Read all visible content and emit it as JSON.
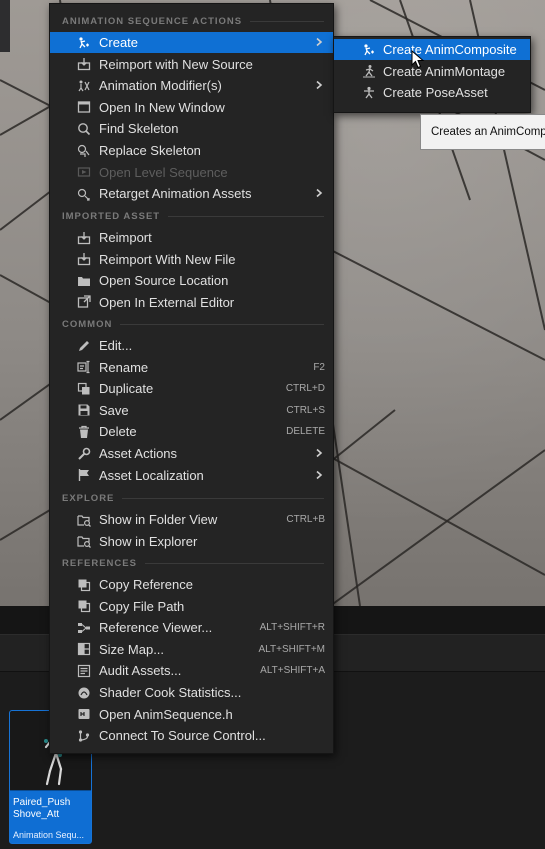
{
  "context_menu": {
    "sections": [
      {
        "header": "ANIMATION SEQUENCE ACTIONS",
        "items": [
          {
            "label": "Create",
            "icon": "create-anim-icon",
            "submenu": true,
            "highlighted": true
          },
          {
            "label": "Reimport with New Source",
            "icon": "reimport-icon"
          },
          {
            "label": "Animation Modifier(s)",
            "icon": "modifier-icon",
            "submenu": true
          },
          {
            "label": "Open In New Window",
            "icon": "window-icon"
          },
          {
            "label": "Find Skeleton",
            "icon": "search-icon"
          },
          {
            "label": "Replace Skeleton",
            "icon": "skeleton-icon"
          },
          {
            "label": "Open Level Sequence",
            "icon": "sequence-icon",
            "disabled": true
          },
          {
            "label": "Retarget Animation Assets",
            "icon": "retarget-icon",
            "submenu": true
          }
        ]
      },
      {
        "header": "IMPORTED ASSET",
        "items": [
          {
            "label": "Reimport",
            "icon": "reimport-icon"
          },
          {
            "label": "Reimport With New File",
            "icon": "reimport-file-icon"
          },
          {
            "label": "Open Source Location",
            "icon": "folder-icon"
          },
          {
            "label": "Open In External Editor",
            "icon": "external-editor-icon"
          }
        ]
      },
      {
        "header": "COMMON",
        "items": [
          {
            "label": "Edit...",
            "icon": "pencil-icon"
          },
          {
            "label": "Rename",
            "icon": "rename-icon",
            "shortcut": "F2"
          },
          {
            "label": "Duplicate",
            "icon": "duplicate-icon",
            "shortcut": "CTRL+D"
          },
          {
            "label": "Save",
            "icon": "save-icon",
            "shortcut": "CTRL+S"
          },
          {
            "label": "Delete",
            "icon": "trash-icon",
            "shortcut": "DELETE"
          },
          {
            "label": "Asset Actions",
            "icon": "wrench-icon",
            "submenu": true
          },
          {
            "label": "Asset Localization",
            "icon": "flag-icon",
            "submenu": true
          }
        ]
      },
      {
        "header": "EXPLORE",
        "items": [
          {
            "label": "Show in Folder View",
            "icon": "folder-search-icon",
            "shortcut": "CTRL+B"
          },
          {
            "label": "Show in Explorer",
            "icon": "folder-search-icon"
          }
        ]
      },
      {
        "header": "REFERENCES",
        "items": [
          {
            "label": "Copy Reference",
            "icon": "copy-icon"
          },
          {
            "label": "Copy File Path",
            "icon": "copy-icon"
          },
          {
            "label": "Reference Viewer...",
            "icon": "reference-viewer-icon",
            "shortcut": "ALT+SHIFT+R"
          },
          {
            "label": "Size Map...",
            "icon": "size-map-icon",
            "shortcut": "ALT+SHIFT+M"
          },
          {
            "label": "Audit Assets...",
            "icon": "audit-icon",
            "shortcut": "ALT+SHIFT+A"
          },
          {
            "label": "Shader Cook Statistics...",
            "icon": "shader-icon"
          },
          {
            "label": "Open AnimSequence.h",
            "icon": "header-file-icon"
          },
          {
            "label": "Connect To Source Control...",
            "icon": "source-control-icon"
          }
        ]
      }
    ]
  },
  "create_submenu": {
    "items": [
      {
        "label": "Create AnimComposite",
        "icon": "anim-composite-icon",
        "highlighted": true
      },
      {
        "label": "Create AnimMontage",
        "icon": "anim-montage-icon"
      },
      {
        "label": "Create PoseAsset",
        "icon": "pose-asset-icon"
      }
    ]
  },
  "tooltip": {
    "text": "Creates an AnimComp"
  },
  "asset_tile": {
    "name": "Paired_Push Shove_Att",
    "type": "Animation Sequ..."
  },
  "colors": {
    "highlight": "#0f70d4",
    "menu_bg": "#242424",
    "asset_blue": "#0f6ed3"
  }
}
